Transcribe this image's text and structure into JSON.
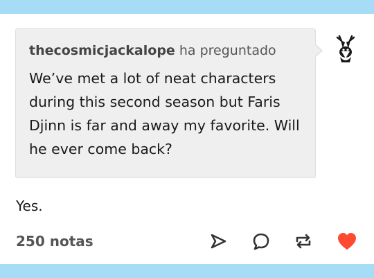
{
  "ask": {
    "asker": "thecosmicjackalope",
    "verb": "ha preguntado",
    "question": "We’ve met a lot of neat characters during this second season but Faris Djinn is far and away my favorite. Will he ever come back?"
  },
  "answer": "Yes.",
  "footer": {
    "notes": "250 notas"
  },
  "icons": {
    "share": "share-icon",
    "reply": "reply-icon",
    "reblog": "reblog-icon",
    "like": "heart-icon"
  },
  "colors": {
    "band": "#a6dcf6",
    "heart": "#ff4930",
    "icon": "#333333"
  }
}
